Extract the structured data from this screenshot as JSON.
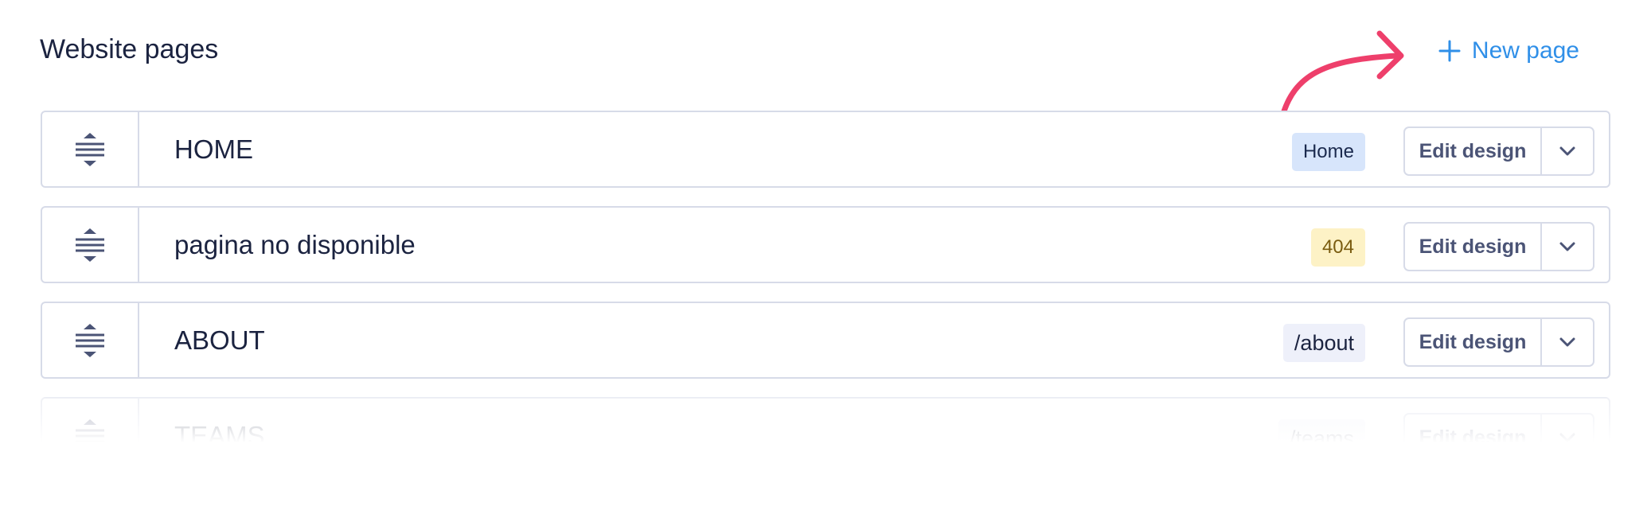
{
  "header": {
    "title": "Website pages",
    "new_page_label": "New page"
  },
  "pages": [
    {
      "name": "HOME",
      "badge": "Home",
      "edit_label": "Edit design"
    },
    {
      "name": "pagina no disponible",
      "badge": "404",
      "edit_label": "Edit design"
    },
    {
      "name": "ABOUT",
      "badge": "/about",
      "edit_label": "Edit design"
    },
    {
      "name": "TEAMS",
      "badge": "/teams",
      "edit_label": "Edit design"
    }
  ],
  "icons": {
    "drag": "drag-handle-icon",
    "chevron": "chevron-down-icon",
    "plus": "plus-icon",
    "arrow": "curved-arrow-icon"
  },
  "colors": {
    "accent": "#2f8fe8",
    "arrow": "#ee3f6b",
    "home_badge": "#d7e5fb",
    "notfound_badge": "#fdf2c6",
    "path_badge": "#eef0fa",
    "border": "#d7dbe8"
  }
}
